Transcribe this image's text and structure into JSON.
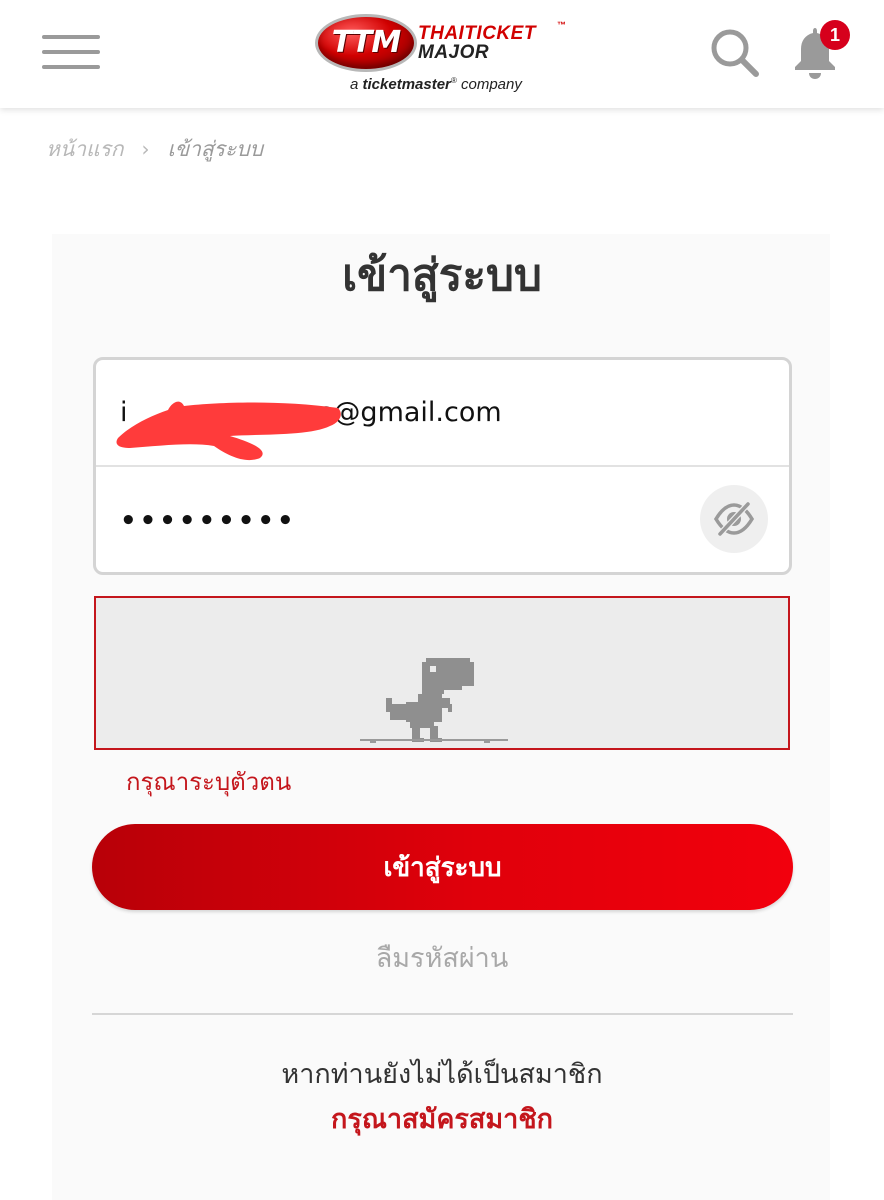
{
  "header": {
    "logo": {
      "mark": "TTM",
      "brand_line1": "THAITICKET",
      "brand_tm": "™",
      "brand_line2": "MAJOR",
      "tagline_pre": "a ",
      "tagline_brand": "ticketmaster",
      "tagline_reg": "®",
      "tagline_post": " company"
    },
    "notification_count": "1",
    "icons": [
      "menu-icon",
      "search-icon",
      "bell-icon"
    ]
  },
  "breadcrumb": {
    "home": "หน้าแรก",
    "separator": "›",
    "current": "เข้าสู่ระบบ"
  },
  "login": {
    "title": "เข้าสู่ระบบ",
    "email_value": "i                      n@gmail.com",
    "password_value": "•••••••••",
    "captcha_error": "กรุณาระบุตัวตน",
    "submit_label": "เข้าสู่ระบบ",
    "forgot_password": "ลืมรหัสผ่าน",
    "not_member_text": "หากท่านยังไม่ได้เป็นสมาชิก",
    "register_link": "กรุณาสมัครสมาชิก"
  },
  "colors": {
    "brand_red": "#d10000",
    "error_red": "#c4161c",
    "redaction": "#ff3b3b"
  }
}
